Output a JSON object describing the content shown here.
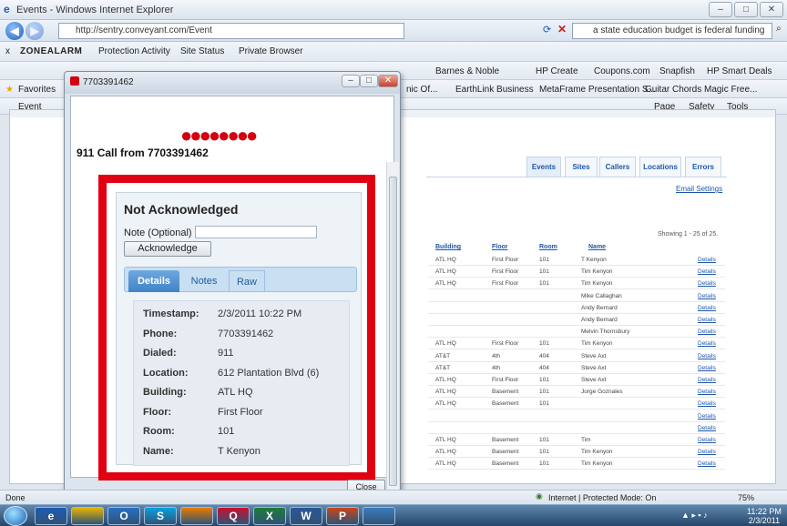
{
  "browser": {
    "window_title": "Events - Windows Internet Explorer",
    "address": "http://sentry.conveyant.com/Event",
    "address_domain": "conveyant.com",
    "search_text": "a state education budget is federal funding",
    "toolbar1": {
      "close": "x",
      "brand": "ZONEALARM",
      "protection": "Protection Activity",
      "site_status": "Site Status",
      "private": "Private Browser"
    },
    "toolbar2": {
      "items": [
        "Barnes & Noble",
        "HP Create",
        "Coupons.com",
        "Snapfish",
        "HP Smart Deals"
      ]
    },
    "favorites_label": "Favorites",
    "fav_items": [
      "nic Of...",
      "EarthLink Business",
      "MetaFrame Presentation S...",
      "Guitar Chords Magic Free..."
    ],
    "tab_label": "Event",
    "command_items": [
      "Page",
      "Safety",
      "Tools"
    ],
    "status_left": "Done",
    "status_zone": "Internet | Protected Mode: On",
    "zoom": "75%",
    "clock_time": "11:22 PM",
    "clock_date": "2/3/2011"
  },
  "site": {
    "tabs": [
      "Events",
      "Sites",
      "Callers",
      "Locations",
      "Errors"
    ],
    "email_settings": "Email Settings",
    "showing": "Showing 1 - 25 of 25.",
    "columns": [
      "Building",
      "Floor",
      "Room",
      "Name"
    ],
    "rows": [
      {
        "building": "ATL HQ",
        "floor": "First Floor",
        "room": "101",
        "name": "T Kenyon"
      },
      {
        "building": "ATL HQ",
        "floor": "First Floor",
        "room": "101",
        "name": "Tim Kenyon"
      },
      {
        "building": "ATL HQ",
        "floor": "First Floor",
        "room": "101",
        "name": "Tim Kenyon"
      },
      {
        "building": "",
        "floor": "",
        "room": "",
        "name": "Mike Callaghan"
      },
      {
        "building": "",
        "floor": "",
        "room": "",
        "name": "Andy Bernard"
      },
      {
        "building": "",
        "floor": "",
        "room": "",
        "name": "Andy Bernard"
      },
      {
        "building": "",
        "floor": "",
        "room": "",
        "name": "Melvin Thornsbury"
      },
      {
        "building": "ATL HQ",
        "floor": "First Floor",
        "room": "101",
        "name": "Tim Kenyon"
      },
      {
        "building": "AT&T",
        "floor": "4th",
        "room": "404",
        "name": "Steve Axt"
      },
      {
        "building": "AT&T",
        "floor": "4th",
        "room": "404",
        "name": "Steve Axt"
      },
      {
        "building": "ATL HQ",
        "floor": "First Floor",
        "room": "101",
        "name": "Steve Axt"
      },
      {
        "building": "ATL HQ",
        "floor": "Basement",
        "room": "101",
        "name": "Jorge Goznales"
      },
      {
        "building": "ATL HQ",
        "floor": "Basement",
        "room": "101",
        "name": ""
      },
      {
        "building": "",
        "floor": "",
        "room": "",
        "name": ""
      },
      {
        "building": "",
        "floor": "",
        "room": "",
        "name": ""
      },
      {
        "building": "ATL HQ",
        "floor": "Basement",
        "room": "101",
        "name": "Tim"
      },
      {
        "building": "ATL HQ",
        "floor": "Basement",
        "room": "101",
        "name": "Tim Kenyon"
      },
      {
        "building": "ATL HQ",
        "floor": "Basement",
        "room": "101",
        "name": "Tim Kenyon"
      }
    ],
    "details_link": "Details"
  },
  "popup": {
    "title": "7703391462",
    "heading": "911 Call from 7703391462",
    "status": "Not Acknowledged",
    "note_label": "Note (Optional)",
    "note_value": "",
    "ack_button": "Acknowledge",
    "tabs": [
      "Details",
      "Notes",
      "Raw"
    ],
    "details": [
      {
        "label": "Timestamp:",
        "value": "2/3/2011 10:22 PM"
      },
      {
        "label": "Phone:",
        "value": "7703391462"
      },
      {
        "label": "Dialed:",
        "value": "911"
      },
      {
        "label": "Location:",
        "value": "612 Plantation Blvd (6)"
      },
      {
        "label": "Building:",
        "value": "ATL HQ"
      },
      {
        "label": "Floor:",
        "value": "First Floor"
      },
      {
        "label": "Room:",
        "value": "101"
      },
      {
        "label": "Name:",
        "value": "T Kenyon"
      }
    ],
    "close_button": "Close",
    "accent": "#e10012"
  },
  "taskbar": {
    "apps": [
      "e",
      "",
      "O",
      "S",
      "",
      "Q",
      "X",
      "W",
      "P",
      ""
    ]
  }
}
